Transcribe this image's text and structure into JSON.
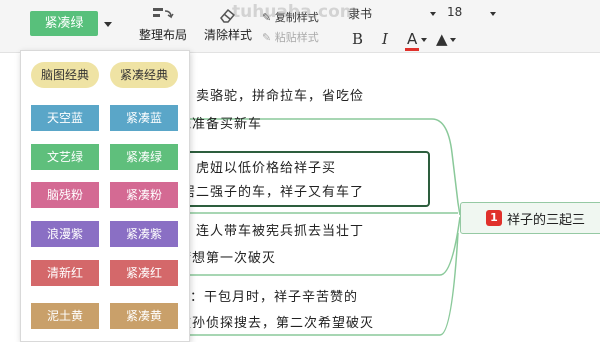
{
  "toolbar": {
    "theme_label": "紧凑绿",
    "tidy_label": "整理布局",
    "clear_label": "清除样式",
    "copy_style_label": "复制样式",
    "paste_style_label": "粘贴样式",
    "font_name": "隶书",
    "font_size": "18",
    "bold": "B",
    "italic": "I",
    "font_color": "A",
    "watermark": "tuhuaba.com"
  },
  "themes": [
    {
      "label": "脑图经典",
      "bg": "#efe3a4",
      "pill": true
    },
    {
      "label": "紧凑经典",
      "bg": "#efe3a4",
      "pill": true
    },
    {
      "label": "天空蓝",
      "bg": "#5aa6c8"
    },
    {
      "label": "紧凑蓝",
      "bg": "#5aa6c8"
    },
    {
      "label": "文艺绿",
      "bg": "#5fbf7c"
    },
    {
      "label": "紧凑绿",
      "bg": "#5fbf7c"
    },
    {
      "label": "脑残粉",
      "bg": "#d46a93"
    },
    {
      "label": "紧凑粉",
      "bg": "#d46a93"
    },
    {
      "label": "浪漫紫",
      "bg": "#8a6fc4"
    },
    {
      "label": "紧凑紫",
      "bg": "#8a6fc4"
    },
    {
      "label": "清新红",
      "bg": "#d4686a"
    },
    {
      "label": "紧凑红",
      "bg": "#d4686a"
    },
    {
      "label": "泥土黄",
      "bg": "#c9a06a"
    },
    {
      "label": "紧凑黄",
      "bg": "#c9a06a"
    }
  ],
  "map": {
    "branch1_line1": "车：卖骆驼，拼命拉车，省吃俭",
    "branch1_line2": "钱准备买新车",
    "branch2_line1": "车：虎妞以低价格给祥子买",
    "branch2_line2": "邻居二强子的车，祥子又有车了",
    "branch3_line1": "车：连人带车被宪兵抓去当壮丁",
    "branch3_line2": "梦想第一次破灭",
    "branch4_line1": "：干包月时，祥子辛苦赞的",
    "branch4_line2": "被孙侦探搜去，第二次希望破灭",
    "central_badge": "1",
    "central_text": "祥子的三起三"
  }
}
